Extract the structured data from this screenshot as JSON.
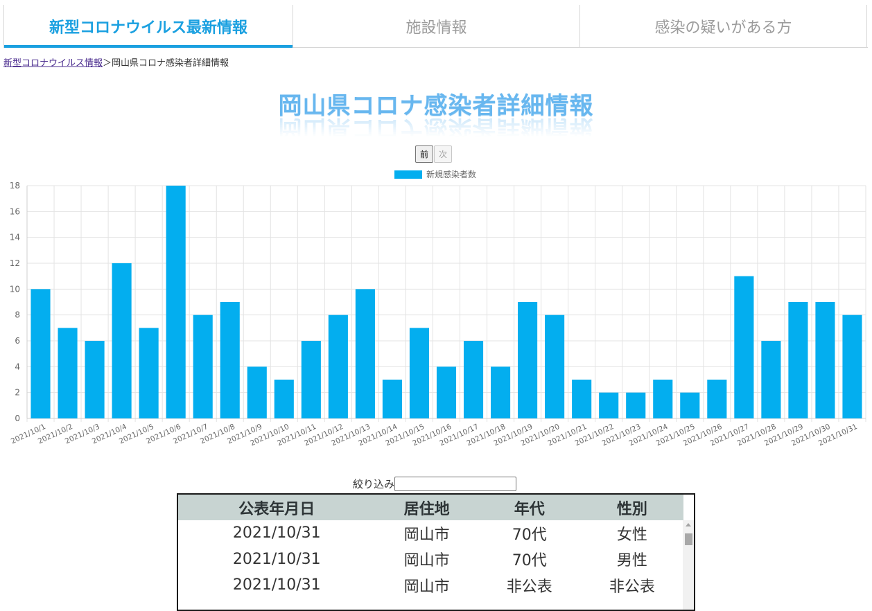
{
  "tabs": [
    {
      "label": "新型コロナウイルス最新情報",
      "active": true
    },
    {
      "label": "施設情報",
      "active": false
    },
    {
      "label": "感染の疑いがある方",
      "active": false
    }
  ],
  "breadcrumb": {
    "link": "新型コロナウイルス情報",
    "separator": "＞",
    "current": "岡山県コロナ感染者詳細情報"
  },
  "page_title": "岡山県コロナ感染者詳細情報",
  "nav": {
    "prev_label": "前",
    "next_label": "次"
  },
  "colors": {
    "accent": "#1aa0e0",
    "bar": "#03aeef",
    "title": "#68b7ef"
  },
  "chart_data": {
    "type": "bar",
    "categories": [
      "2021/10/1",
      "2021/10/2",
      "2021/10/3",
      "2021/10/4",
      "2021/10/5",
      "2021/10/6",
      "2021/10/7",
      "2021/10/8",
      "2021/10/9",
      "2021/10/10",
      "2021/10/11",
      "2021/10/12",
      "2021/10/13",
      "2021/10/14",
      "2021/10/15",
      "2021/10/16",
      "2021/10/17",
      "2021/10/18",
      "2021/10/19",
      "2021/10/20",
      "2021/10/21",
      "2021/10/22",
      "2021/10/23",
      "2021/10/24",
      "2021/10/25",
      "2021/10/26",
      "2021/10/27",
      "2021/10/28",
      "2021/10/29",
      "2021/10/30",
      "2021/10/31"
    ],
    "series": [
      {
        "name": "新規感染者数",
        "color": "#03aeef",
        "values": [
          10,
          7,
          6,
          12,
          7,
          18,
          8,
          9,
          4,
          3,
          6,
          8,
          10,
          3,
          7,
          4,
          6,
          4,
          9,
          8,
          3,
          2,
          2,
          3,
          2,
          3,
          11,
          6,
          9,
          9,
          8
        ]
      }
    ],
    "ylim": [
      0,
      18
    ],
    "yticks": [
      0,
      2,
      4,
      6,
      8,
      10,
      12,
      14,
      16,
      18
    ],
    "grid": true,
    "legend_position": "top-center"
  },
  "filter": {
    "label": "絞り込み",
    "value": ""
  },
  "table": {
    "headers": [
      "公表年月日",
      "居住地",
      "年代",
      "性別"
    ],
    "rows": [
      [
        "2021/10/31",
        "岡山市",
        "70代",
        "女性"
      ],
      [
        "2021/10/31",
        "岡山市",
        "70代",
        "男性"
      ],
      [
        "2021/10/31",
        "岡山市",
        "非公表",
        "非公表"
      ]
    ]
  }
}
